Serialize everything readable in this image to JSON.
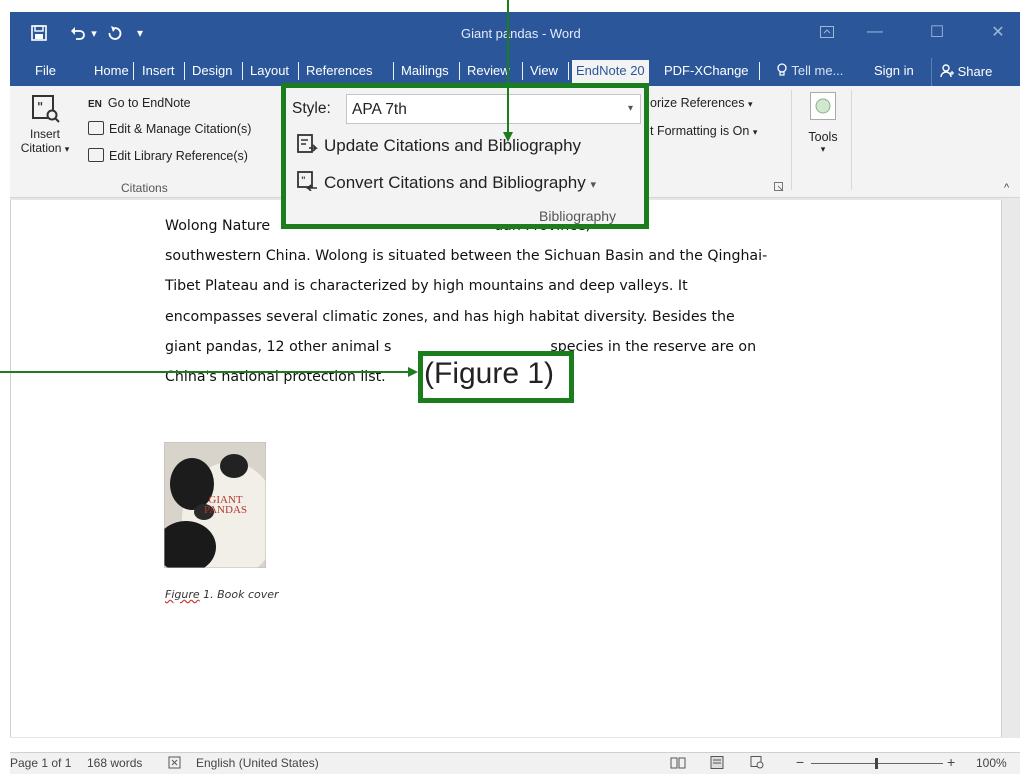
{
  "window": {
    "title": "Giant pandas - Word",
    "quick_access": {
      "save": "🖫",
      "undo": "↶",
      "undo_more": "▾",
      "redo": "↷",
      "customize": "▾"
    },
    "controls": {
      "ribbon_display": "⊞",
      "minimize": "—",
      "maximize": "☐",
      "close": "✕"
    }
  },
  "tabs": [
    "File",
    "Home",
    "Insert",
    "Design",
    "Layout",
    "References",
    "Mailings",
    "Review",
    "View",
    "EndNote 20",
    "PDF-XChange"
  ],
  "active_tab": "EndNote 20",
  "tell_me": "Tell me...",
  "sign_in": "Sign in",
  "share": "Share",
  "ribbon": {
    "insert_citation": {
      "line1": "Insert",
      "line2": "Citation"
    },
    "go_to_endnote": "Go to EndNote",
    "en_badge": "EN",
    "edit_manage_citations": "Edit & Manage Citation(s)",
    "edit_library_reference": "Edit Library Reference(s)",
    "citations_group": "Citations",
    "categorize_references": "orize References",
    "instant_formatting": "t Formatting is On",
    "tools": "Tools",
    "bibliography_group": "Bibliography"
  },
  "bibliography_callout": {
    "style_label": "Style:",
    "style_value": "APA 7th",
    "update": "Update Citations and Bibliography",
    "convert": "Convert Citations and Bibliography",
    "group_label": "Bibliography"
  },
  "document": {
    "line1_a": "Wolong Nature",
    "line1_b": "uan Province,",
    "line2": "southwestern China. Wolong is situated between the Sichuan Basin and the Qinghai-",
    "line3": "Tibet Plateau and is characterized by high mountains and deep valleys.    It",
    "line4": "encompasses several climatic zones, and has high habitat diversity.    Besides the",
    "line5_a": "giant pandas, 12 other animal s",
    "line5_b": "species in the reserve are on",
    "line6": "China's national protection list.",
    "figure_citation": "(Figure 1)",
    "book_text_1": "GIANT",
    "book_text_2": "PANDAS",
    "caption_label": "Figure",
    "caption_rest": " 1. Book cover"
  },
  "status": {
    "page": "Page 1 of 1",
    "words": "168 words",
    "language": "English (United States)",
    "zoom": "100%",
    "zoom_minus": "−",
    "zoom_plus": "+"
  },
  "colors": {
    "word_blue": "#2b579a",
    "callout_green": "#1b7d1b"
  }
}
